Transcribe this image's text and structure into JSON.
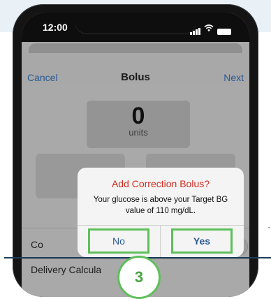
{
  "status_bar": {
    "time": "12:00"
  },
  "nav": {
    "cancel": "Cancel",
    "title": "Bolus",
    "next": "Next"
  },
  "units": {
    "value": "0",
    "label": "units"
  },
  "rows": {
    "correction_label": "Co",
    "delivery_label": "Delivery Calcula"
  },
  "alert": {
    "title": "Add Correction Bolus?",
    "message": "Your glucose is above your Target BG value of 110 mg/dL.",
    "no_label": "No",
    "yes_label": "Yes"
  },
  "step_badge": "3",
  "colors": {
    "alert_title": "#d22b1f",
    "link_blue": "#2a5a93",
    "highlight_green": "#5fbf5a",
    "badge_text": "#4aa346",
    "baseline": "#1d3c5a"
  },
  "icons": [
    "signal-icon",
    "wifi-icon",
    "battery-icon"
  ]
}
